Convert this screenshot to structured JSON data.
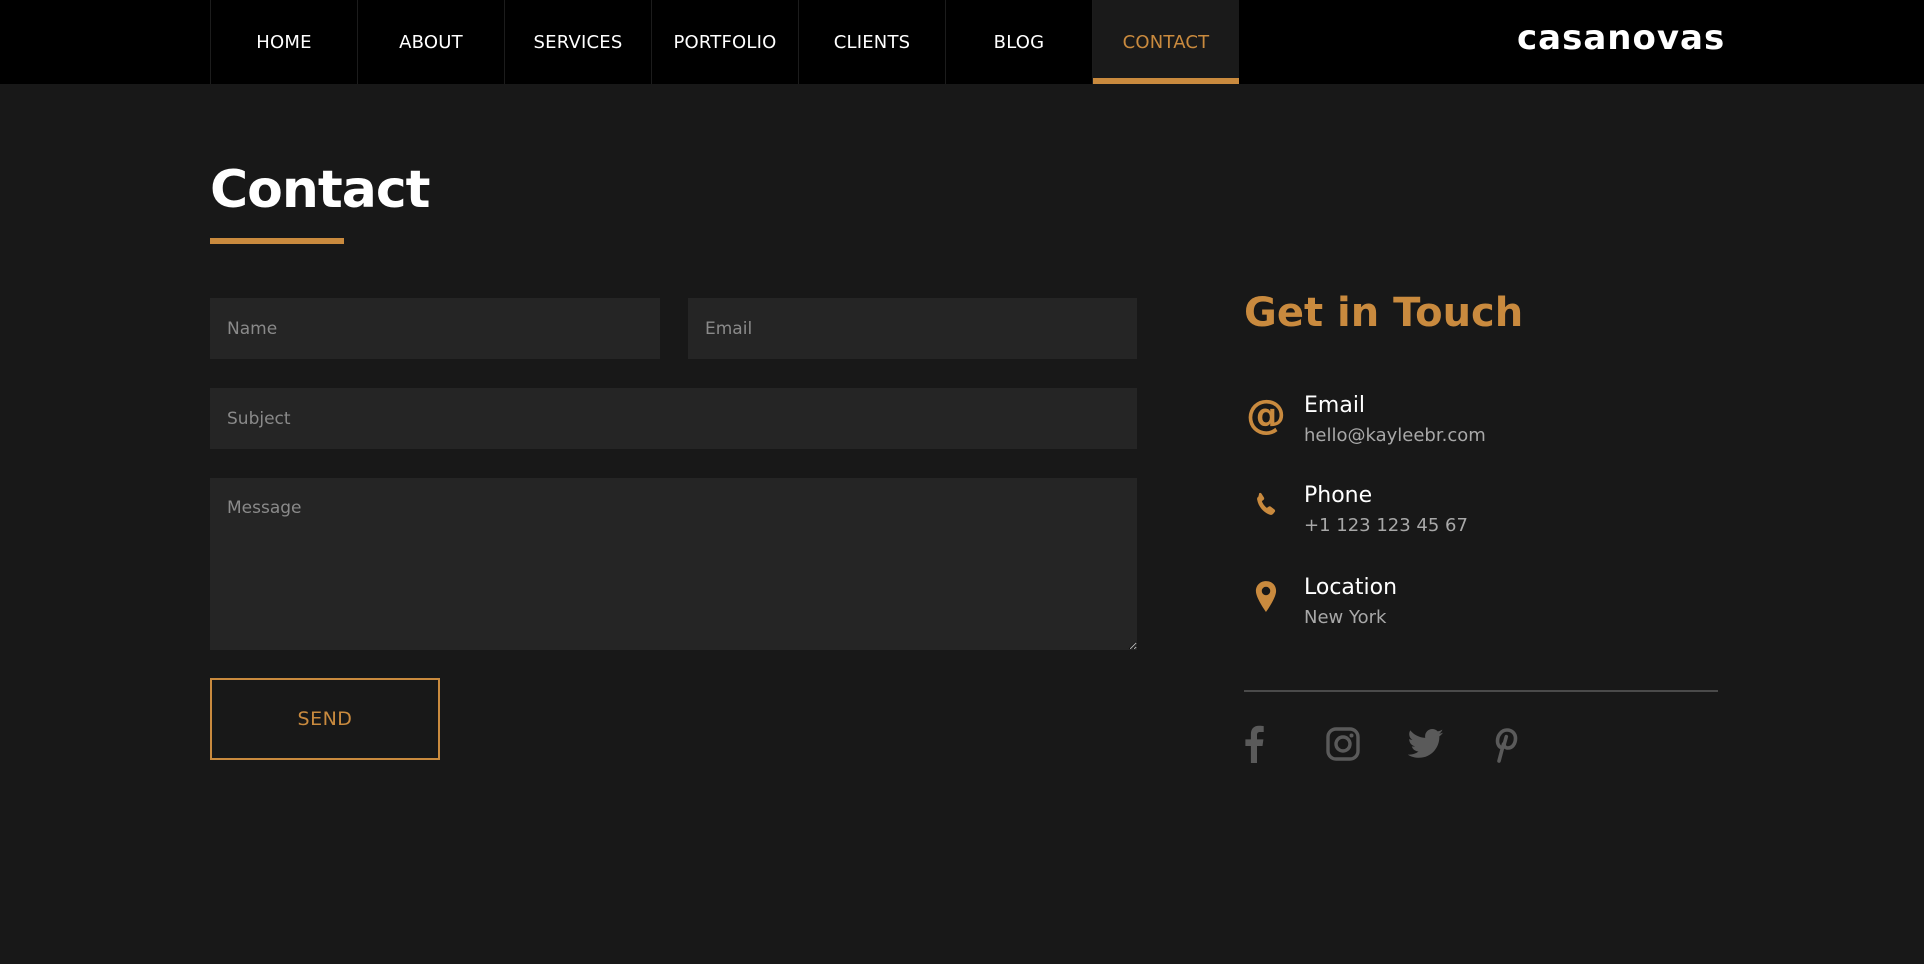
{
  "nav": {
    "items": [
      {
        "label": "HOME"
      },
      {
        "label": "ABOUT"
      },
      {
        "label": "SERVICES"
      },
      {
        "label": "PORTFOLIO"
      },
      {
        "label": "CLIENTS"
      },
      {
        "label": "BLOG"
      },
      {
        "label": "CONTACT",
        "active": true
      }
    ],
    "logo": "casanovas"
  },
  "page": {
    "title": "Contact"
  },
  "form": {
    "name_placeholder": "Name",
    "email_placeholder": "Email",
    "subject_placeholder": "Subject",
    "message_placeholder": "Message",
    "send_label": "SEND"
  },
  "touch": {
    "title": "Get in Touch",
    "email_label": "Email",
    "email_value": "hello@kayleebr.com",
    "phone_label": "Phone",
    "phone_value": "+1 123 123 45 67",
    "location_label": "Location",
    "location_value": "New York"
  },
  "socials": [
    "facebook-icon",
    "instagram-icon",
    "twitter-icon",
    "pinterest-icon"
  ],
  "colors": {
    "accent": "#c98a3e",
    "background": "#181818",
    "nav_background": "#000000",
    "field_background": "#252525",
    "social_icon": "#5a5a5a"
  }
}
